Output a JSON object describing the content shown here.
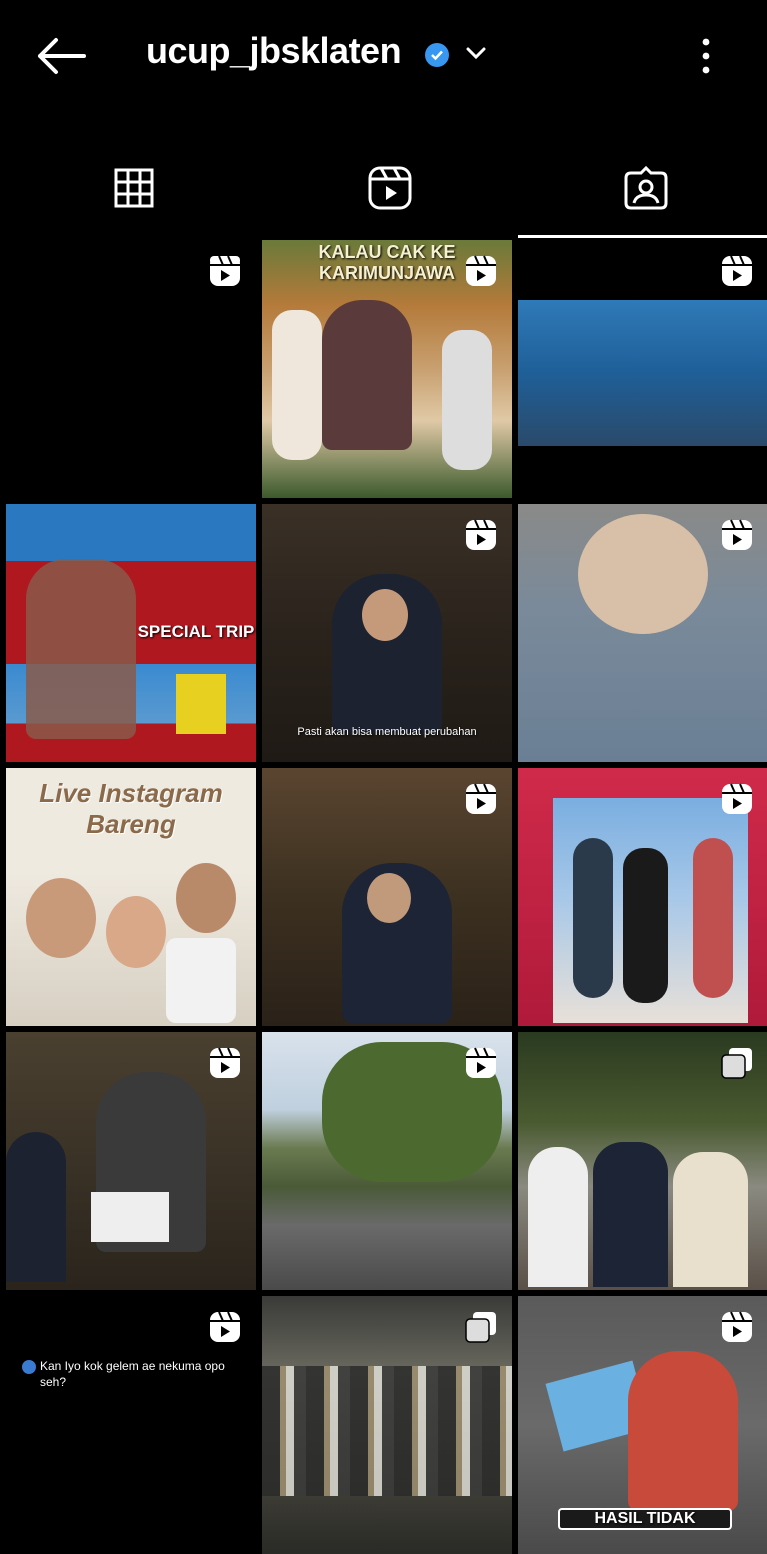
{
  "header": {
    "username": "ucup_jbsklaten",
    "back_icon": "arrow-left-icon",
    "verified_icon": "verified-badge-icon",
    "dropdown_icon": "chevron-down-icon",
    "menu_icon": "more-vertical-icon"
  },
  "tabs": [
    {
      "icon": "grid-icon",
      "active": false
    },
    {
      "icon": "reels-icon",
      "active": false
    },
    {
      "icon": "tagged-icon",
      "active": true
    }
  ],
  "posts": [
    {
      "type": "reel",
      "caption": ""
    },
    {
      "type": "reel",
      "caption": "KALAU CAK KE KARIMUNJAWA"
    },
    {
      "type": "reel",
      "caption": ""
    },
    {
      "type": "carousel",
      "caption": "SPECIAL TRIP"
    },
    {
      "type": "reel",
      "caption": "Pasti akan bisa membuat perubahan"
    },
    {
      "type": "reel",
      "caption": ""
    },
    {
      "type": "image",
      "caption": "Live Instagram Bareng"
    },
    {
      "type": "reel",
      "caption": ""
    },
    {
      "type": "reel",
      "caption": ""
    },
    {
      "type": "reel",
      "caption": ""
    },
    {
      "type": "reel",
      "caption": ""
    },
    {
      "type": "carousel",
      "caption": ""
    },
    {
      "type": "reel",
      "caption": "Kan Iyo kok gelem ae nekuma opo seh?"
    },
    {
      "type": "carousel",
      "caption": ""
    },
    {
      "type": "reel",
      "caption": "HASIL TIDAK"
    }
  ],
  "colors": {
    "background": "#000000",
    "verified": "#3897f0",
    "text": "#ffffff"
  }
}
